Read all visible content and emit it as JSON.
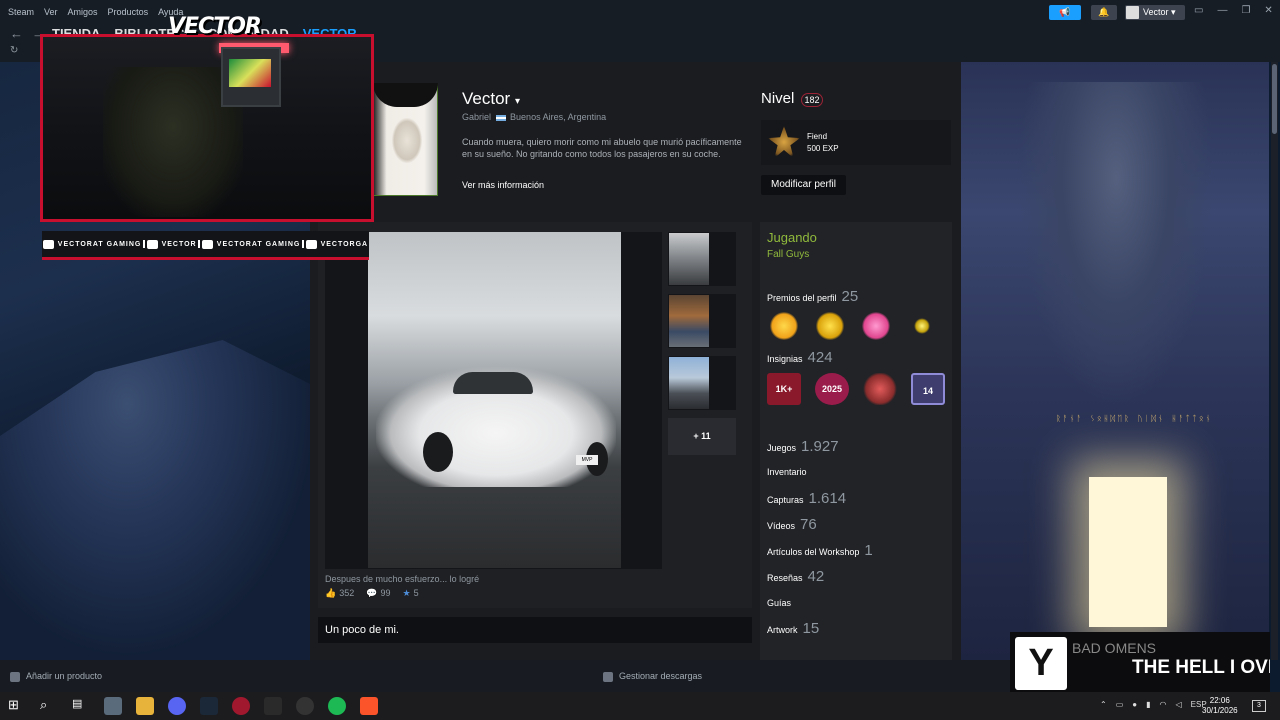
{
  "app": {
    "menu": [
      "Steam",
      "Ver",
      "Amigos",
      "Productos",
      "Ayuda"
    ],
    "nav_tabs": [
      "TIENDA",
      "BIBLIOTECA",
      "COMUNIDAD",
      "VECTOR"
    ],
    "user_label": "Vector",
    "accent": "#1a9fff"
  },
  "overlay": {
    "logo_text": "VECTOR",
    "social": [
      {
        "icon": "youtube-icon",
        "label": "VECTORAT GAMING"
      },
      {
        "icon": "twitch-icon",
        "label": "VECTOR"
      },
      {
        "icon": "twitter-icon",
        "label": "VECTORAT GAMING"
      },
      {
        "icon": "instagram-icon",
        "label": "VECTORGA"
      }
    ],
    "accent": "#c8102e"
  },
  "profile": {
    "name": "Vector",
    "real_name": "Gabriel",
    "location": "Buenos Aires, Argentina",
    "summary": "Cuando muera, quiero morir como mi abuelo que murió pacíficamente en su sueño. No gritando como todos los pasajeros en su coche.",
    "more_info": "Ver más información",
    "level_label": "Nivel",
    "level": "182",
    "badge_name": "Fiend",
    "badge_exp": "500 EXP",
    "edit_label": "Modificar perfil"
  },
  "showcase": {
    "caption": "Despues de mucho esfuerzo... lo logré",
    "likes": "352",
    "comments": "99",
    "awards": "5",
    "more": "+ 11",
    "plate": "MVP"
  },
  "about": {
    "title": "Un poco de mi."
  },
  "sidebar": {
    "playing_label": "Jugando",
    "playing_game": "Fall Guys",
    "awards_label": "Premios del perfil",
    "awards_count": "25",
    "badges_label": "Insignias",
    "badges_count": "424",
    "badge1_text": "1K+",
    "badge2_text": "2025",
    "badge4_text": "14",
    "stats": [
      {
        "label": "Juegos",
        "value": "1.927"
      },
      {
        "label": "Inventario",
        "value": ""
      },
      {
        "label": "Capturas",
        "value": "1.614"
      },
      {
        "label": "Vídeos",
        "value": "76"
      },
      {
        "label": "Artículos del Workshop",
        "value": "1"
      },
      {
        "label": "Reseñas",
        "value": "42"
      },
      {
        "label": "Guías",
        "value": ""
      },
      {
        "label": "Artwork",
        "value": "15"
      }
    ]
  },
  "now_playing": {
    "band": "BAD OMENS",
    "song": "THE HELL I OVE"
  },
  "background": {
    "rune_text": "ᚱᚨᚾᚨ ᛊᛟᚺᛞᛖᚱ ᚢᛁᛞᚾ ᚺᚨᛏᛏᛟᚾ"
  },
  "bottom_bar": {
    "add_product": "Añadir un producto",
    "manage_downloads": "Gestionar descargas"
  },
  "taskbar": {
    "lang": "ESP",
    "time": "22:06",
    "date": "30/1/2026",
    "notif_count": "3"
  }
}
